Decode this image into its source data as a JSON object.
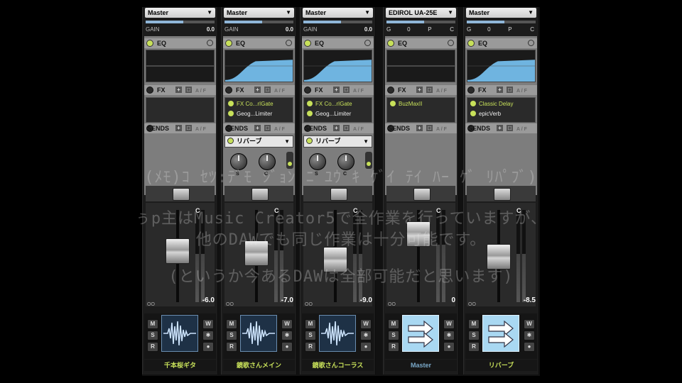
{
  "strips": [
    {
      "output": "Master",
      "gain_label": "GAIN",
      "gain": "0.0",
      "fx": [],
      "send": null,
      "fader_db": "-6.0",
      "name": "千本桜ギタ",
      "name_color": "#c7e05a",
      "icon": "waveform-icon",
      "clip": "C"
    },
    {
      "output": "Master",
      "gain_label": "GAIN",
      "gain": "0.0",
      "fx": [
        "FX Co...rIGate",
        "Geog...Limiter"
      ],
      "send": "リバーブ",
      "fader_db": "-7.0",
      "name": "鏡歌さんメイン",
      "name_color": "#c7e05a",
      "icon": "waveform-icon",
      "clip": "C"
    },
    {
      "output": "Master",
      "gain_label": "GAIN",
      "gain": "0.0",
      "fx": [
        "FX Co...rIGate",
        "Geog...Limiter"
      ],
      "send": "リバーブ",
      "fader_db": "-9.0",
      "name": "鏡歌さんコーラス",
      "name_color": "#c7e05a",
      "icon": "waveform-icon",
      "clip": "C"
    },
    {
      "output": "EDIROL UA-25E",
      "io": [
        "G",
        "0",
        "P",
        "C"
      ],
      "fx": [
        "BuzMaxII"
      ],
      "send": null,
      "fader_db": "0",
      "name": "Master",
      "name_color": "#7aa8c8",
      "icon": "arrows-icon",
      "clip": "C"
    },
    {
      "output": "Master",
      "io": [
        "G",
        "0",
        "P",
        "C"
      ],
      "fx": [
        "Classic Delay",
        "epicVerb"
      ],
      "send": null,
      "fader_db": "-8.5",
      "name": "リバーブ",
      "name_color": "#c7e05a",
      "icon": "arrows-icon",
      "clip": "C"
    }
  ],
  "labels": {
    "eq": "EQ",
    "fx": "FX",
    "sends": "SENDS",
    "plus": "+",
    "ghost": "A / F",
    "oo": "OO",
    "knob_a": "S",
    "knob_b": "C",
    "mute": "M",
    "solo": "S",
    "record": "R",
    "write": "W"
  },
  "overlay": {
    "line1": "(ﾒﾓ)ｺ ｾﾂ:ﾃﾞﾓ ｼﾞｮﾝ ﾆ ﾕｳ ｷ ｹﾞｲ ﾃｲ ﾊｰ ｹﾞ ﾘﾊﾟﾌﾞ)",
    "line2": "ぅp主はMusic Creator5で全作業を行っていますが、",
    "line3": "他のDAWでも同じ作業は十分可能です。",
    "line4": "(というか今あるDAWは全部可能だと思います)"
  },
  "colors": {
    "accent": "#c7e05a",
    "blue_name": "#7aa8c8"
  }
}
